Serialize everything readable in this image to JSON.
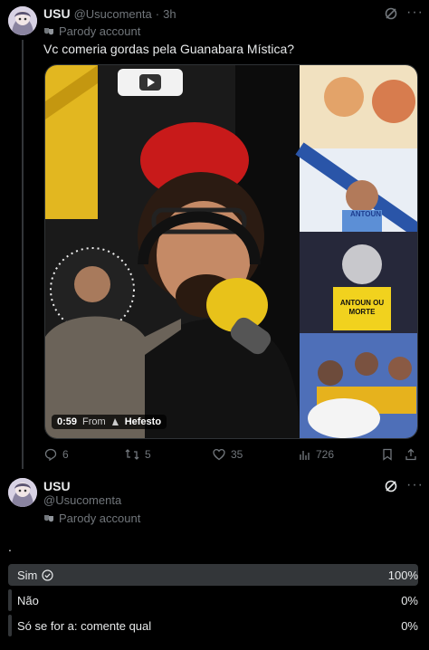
{
  "tweet1": {
    "display_name": "USU",
    "handle": "@Usucomenta",
    "separator": "·",
    "time": "3h",
    "parody_label": "Parody account",
    "text": "Vc comeria gordas pela Guanabara Mística?",
    "video": {
      "timestamp": "0:59",
      "from_label": "From",
      "source": "Hefesto"
    },
    "stats": {
      "replies": "6",
      "reposts": "5",
      "likes": "35",
      "views": "726"
    },
    "panel_texts": {
      "sign1": "ANTOUN",
      "sign2": "ANTOUN OU MORTE"
    }
  },
  "tweet2": {
    "display_name": "USU",
    "handle": "@Usucomenta",
    "parody_label": "Parody account",
    "text": "."
  },
  "poll": {
    "options": [
      {
        "label": "Sim",
        "percent": "100%",
        "value": 1.0,
        "winner": true
      },
      {
        "label": "Não",
        "percent": "0%",
        "value": 0.0,
        "winner": false
      },
      {
        "label": "Só se for a: comente qual",
        "percent": "0%",
        "value": 0.0,
        "winner": false
      }
    ]
  },
  "colors": {
    "background": "#000000",
    "text": "#e7e9ea",
    "muted": "#71767b",
    "poll_fill": "#333639"
  }
}
